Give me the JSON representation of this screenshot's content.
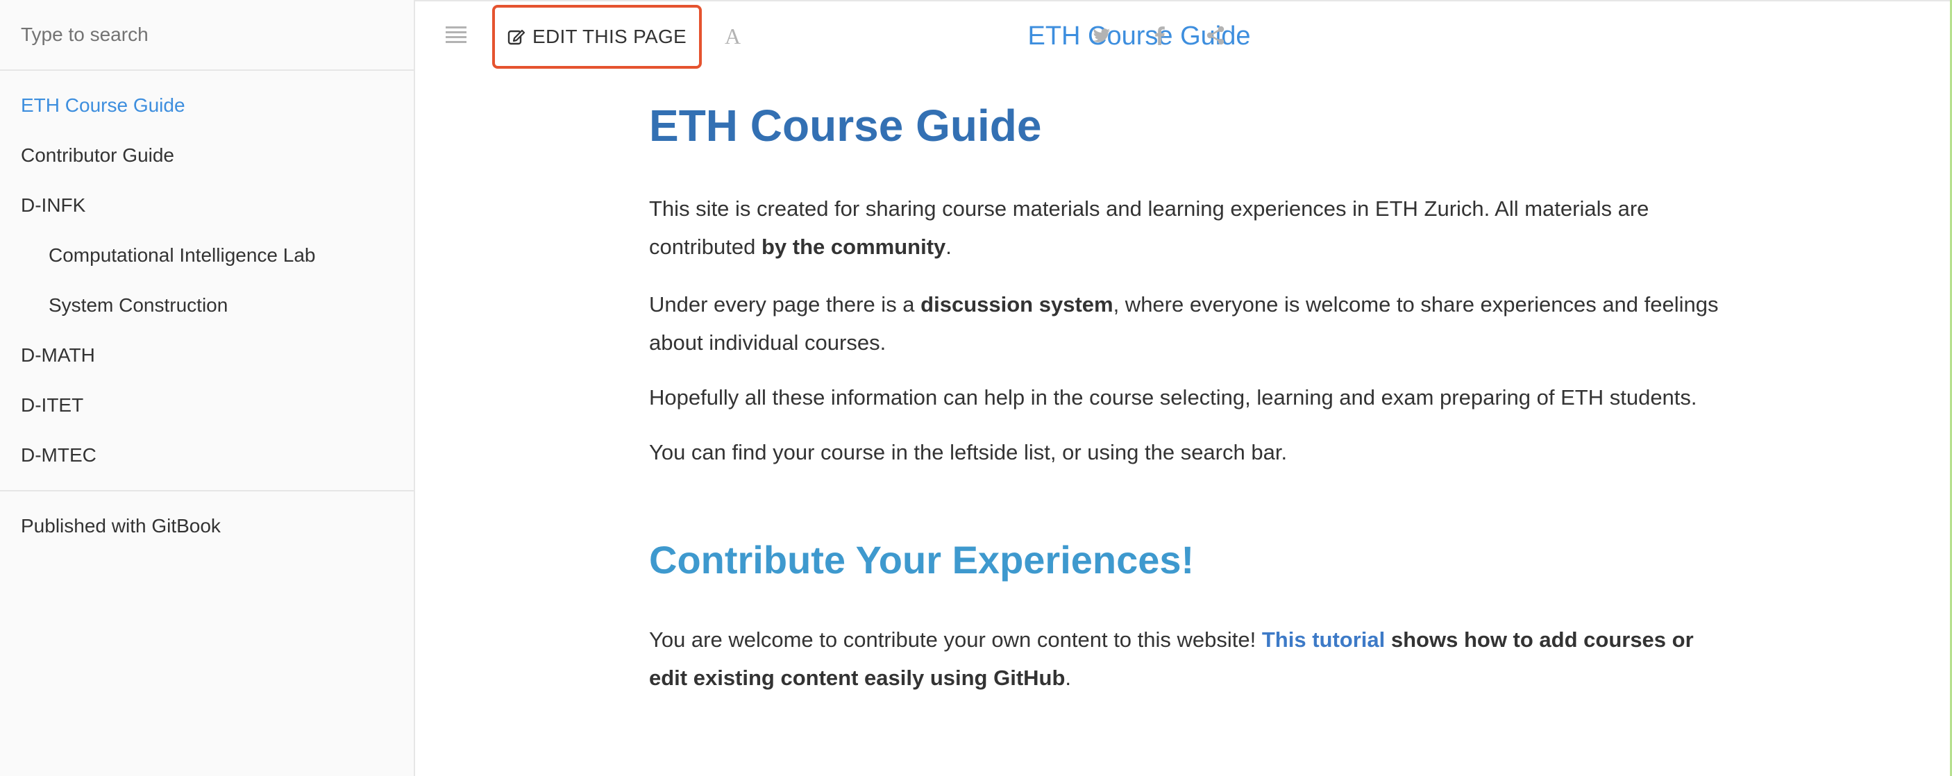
{
  "search": {
    "placeholder": "Type to search"
  },
  "sidebar": {
    "items": [
      {
        "label": "ETH Course Guide",
        "active": true,
        "level": 0
      },
      {
        "label": "Contributor Guide",
        "active": false,
        "level": 0
      },
      {
        "label": "D-INFK",
        "active": false,
        "level": 0
      },
      {
        "label": "Computational Intelligence Lab",
        "active": false,
        "level": 1
      },
      {
        "label": "System Construction",
        "active": false,
        "level": 1
      },
      {
        "label": "D-MATH",
        "active": false,
        "level": 0
      },
      {
        "label": "D-ITET",
        "active": false,
        "level": 0
      },
      {
        "label": "D-MTEC",
        "active": false,
        "level": 0
      }
    ],
    "published": "Published with GitBook"
  },
  "header": {
    "edit_label": "EDIT THIS PAGE",
    "font_glyph": "A",
    "title": "ETH Course Guide",
    "icons": [
      "menu-icon",
      "edit-icon",
      "font-settings-icon",
      "twitter-icon",
      "facebook-icon",
      "share-icon"
    ]
  },
  "content": {
    "title": "ETH Course Guide",
    "p1": {
      "text_a": "This site is created for sharing course materials and learning experiences in ETH Zurich. All materials are contributed ",
      "bold": "by the community",
      "text_b": "."
    },
    "p2": {
      "text_a": "Under every page there is a ",
      "bold": "discussion system",
      "text_b": ", where everyone is welcome to share experiences and feelings about individual courses."
    },
    "p3": "Hopefully all these information can help in the course selecting, learning and exam preparing of ETH students.",
    "p4": "You can find your course in the leftside list, or using the search bar.",
    "section_title": "Contribute Your Experiences!",
    "p5": {
      "text_a": "You are welcome to contribute your own content to this website! ",
      "link": "This tutorial",
      "bold": " shows how to add courses or edit existing content easily using GitHub",
      "text_b": "."
    }
  },
  "colors": {
    "accent": "#3d8ede",
    "h1": "#3370b3",
    "h2": "#3e99ce",
    "highlight_border": "#e5532f"
  }
}
